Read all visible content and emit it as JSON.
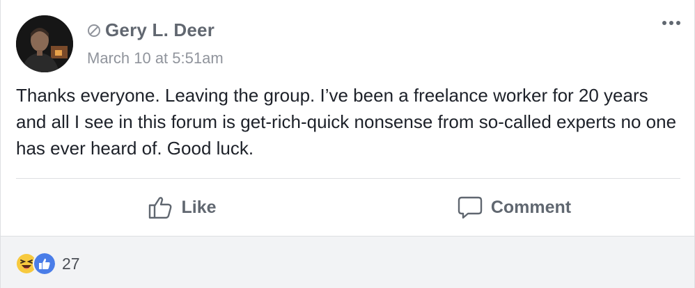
{
  "post": {
    "author": "Gery L. Deer",
    "timestamp": "March 10 at 5:51am",
    "text": "Thanks everyone. Leaving the group. I’ve been a freelance worker for 20 years and all I see in this forum is get-rich-quick nonsense from so-called experts no one has ever heard of. Good luck."
  },
  "actions": {
    "like_label": "Like",
    "comment_label": "Comment"
  },
  "reactions": {
    "icons": [
      "laughing-face-icon",
      "thumbs-up-icon"
    ],
    "count": "27"
  },
  "colors": {
    "like_blue": "#4a7de8",
    "haha_yellow": "#f7c93e",
    "text_gray": "#606770",
    "footer_bg": "#f2f3f5"
  }
}
